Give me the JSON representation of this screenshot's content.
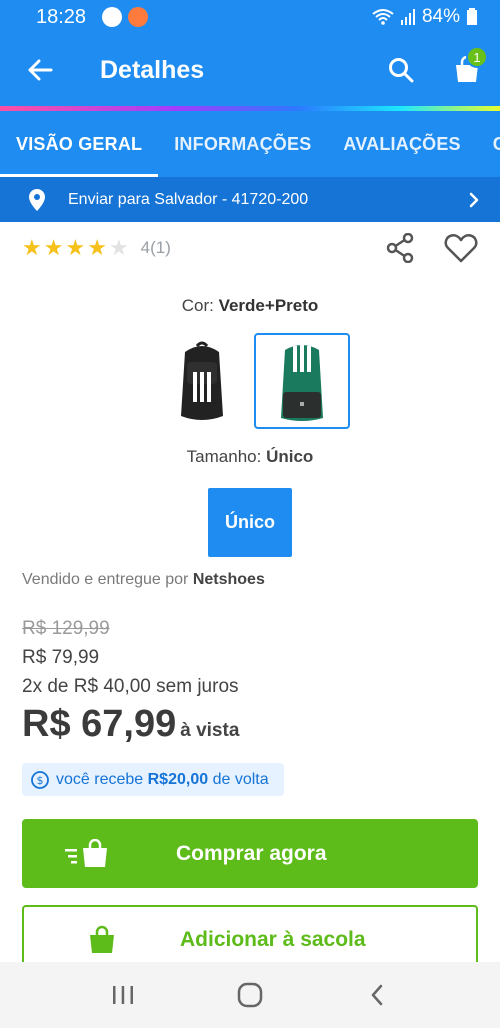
{
  "status_bar": {
    "time": "18:28",
    "battery": "84%"
  },
  "app_bar": {
    "title": "Detalhes",
    "cart_count": "1"
  },
  "tabs": [
    {
      "label": "VISÃO GERAL"
    },
    {
      "label": "INFORMAÇÕES"
    },
    {
      "label": "AVALIAÇÕES"
    },
    {
      "label": "C"
    }
  ],
  "shipping": {
    "text": "Enviar para Salvador - 41720-200"
  },
  "rating": {
    "stars_filled": 4,
    "stars_total": 5,
    "count_text": "4(1)"
  },
  "color": {
    "label": "Cor:",
    "value": "Verde+Preto"
  },
  "size": {
    "label": "Tamanho:",
    "value": "Único",
    "button_label": "Único"
  },
  "seller": {
    "prefix": "Vendido e entregue por",
    "name": "Netshoes"
  },
  "prices": {
    "old": "R$ 129,99",
    "mid": "R$ 79,99",
    "installments": "2x de R$ 40,00 sem juros",
    "main": "R$ 67,99",
    "main_suffix": "à vista"
  },
  "cashback": {
    "prefix": "você recebe",
    "amount": "R$20,00",
    "suffix": "de volta"
  },
  "buttons": {
    "buy_now": "Comprar agora",
    "add_to_bag": "Adicionar à sacola"
  },
  "colors": {
    "primary": "#1e8cf0",
    "green": "#5dbb1a",
    "star": "#f6c11a"
  }
}
